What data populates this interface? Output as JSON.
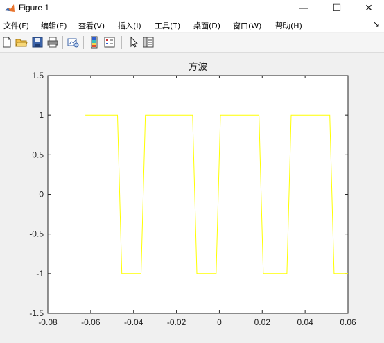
{
  "window": {
    "title": "Figure 1",
    "controls": {
      "minimize": "—",
      "maximize": "☐",
      "close": "✕"
    }
  },
  "menu": {
    "items": [
      {
        "label": "文件(F)"
      },
      {
        "label": "编辑(E)"
      },
      {
        "label": "查看(V)"
      },
      {
        "label": "插入(I)"
      },
      {
        "label": "工具(T)"
      },
      {
        "label": "桌面(D)"
      },
      {
        "label": "窗口(W)"
      },
      {
        "label": "帮助(H)"
      }
    ],
    "dock_icon": "↘"
  },
  "toolbar": {
    "icons": [
      "new-figure-icon",
      "open-folder-icon",
      "save-icon",
      "print-icon",
      "link-plot-icon",
      "insert-colorbar-icon",
      "insert-legend-icon",
      "pointer-icon",
      "property-inspector-icon"
    ]
  },
  "colors": {
    "line": "#ffff00",
    "axes_bg": "#ffffff",
    "figure_bg": "#f0f0f0"
  },
  "chart_data": {
    "type": "line",
    "title": "方波",
    "xlabel": "",
    "ylabel": "",
    "xlim": [
      -0.08,
      0.06
    ],
    "ylim": [
      -1.5,
      1.5
    ],
    "grid": false,
    "x_ticks": [
      "-0.08",
      "-0.06",
      "-0.04",
      "-0.02",
      "0",
      "0.02",
      "0.04",
      "0.06"
    ],
    "x_tick_values": [
      -0.08,
      -0.06,
      -0.04,
      -0.02,
      0,
      0.02,
      0.04,
      0.06
    ],
    "y_ticks": [
      "-1.5",
      "-1",
      "-0.5",
      "0",
      "0.5",
      "1",
      "1.5"
    ],
    "y_tick_values": [
      -1.5,
      -1,
      -0.5,
      0,
      0.5,
      1,
      1.5
    ],
    "series": [
      {
        "x": [
          -0.0625,
          -0.0475,
          -0.0455,
          -0.0365,
          -0.0345,
          -0.0235,
          -0.0215,
          -0.0125,
          -0.0105,
          -0.0015,
          0.0005,
          0.0095,
          0.0115,
          0.0185,
          0.0205,
          0.0315,
          0.0335,
          0.0405,
          0.0425,
          0.0515,
          0.0535,
          0.06
        ],
        "y": [
          1,
          1,
          -1,
          -1,
          1,
          1,
          1,
          1,
          -1,
          -1,
          1,
          1,
          1,
          1,
          -1,
          -1,
          1,
          1,
          1,
          1,
          -1,
          -1
        ]
      }
    ]
  }
}
